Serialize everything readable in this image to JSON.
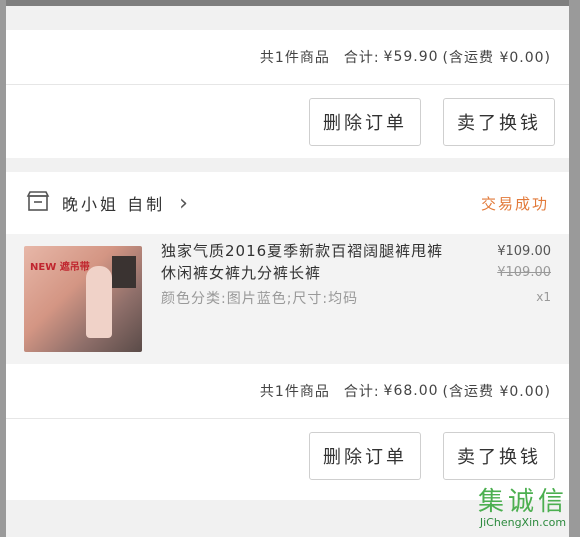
{
  "orders": [
    {
      "summary": {
        "count_text": "共1件商品",
        "total_label": "合计:",
        "total_value": "¥59.90",
        "shipping_text": "(含运费 ¥0.00)"
      },
      "actions": {
        "delete_label": "删除订单",
        "sell_label": "卖了换钱"
      }
    },
    {
      "shop": {
        "name": "晚小姐 自制",
        "status": "交易成功"
      },
      "item": {
        "thumb_text": "NEW 遮吊带",
        "title": "独家气质2016夏季新款百褶阔腿裤甩裤休闲裤女裤九分裤长裤",
        "sku": "颜色分类:图片蓝色;尺寸:均码",
        "price": "¥109.00",
        "original_price": "¥109.00",
        "qty": "x1"
      },
      "summary": {
        "count_text": "共1件商品",
        "total_label": "合计:",
        "total_value": "¥68.00",
        "shipping_text": "(含运费 ¥0.00)"
      },
      "actions": {
        "delete_label": "删除订单",
        "sell_label": "卖了换钱"
      }
    }
  ],
  "watermark": {
    "logo": "集诚信",
    "url": "JiChengXin.com"
  },
  "icons": {
    "shop": "shop-icon",
    "chevron": "chevron-right-icon"
  },
  "colors": {
    "status": "#e27a3a",
    "background": "#f1f1f1"
  }
}
